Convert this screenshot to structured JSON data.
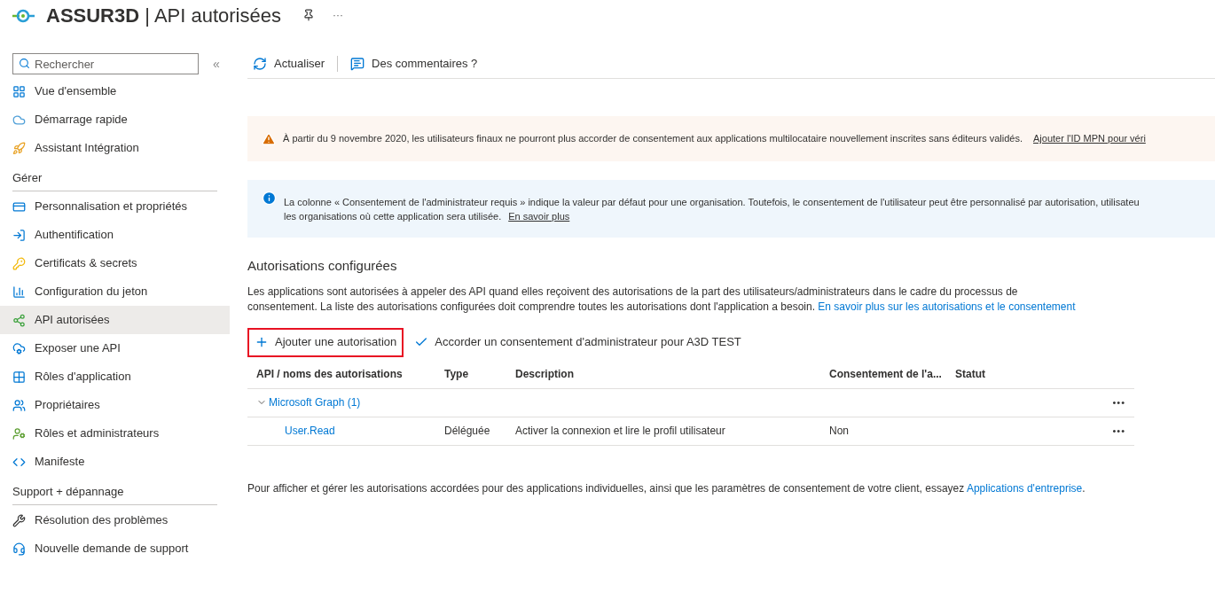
{
  "header": {
    "app_name": "ASSUR3D",
    "separator": "|",
    "page_title": "API autorisées",
    "more": "···"
  },
  "sidebar": {
    "search": {
      "placeholder": "Rechercher"
    },
    "collapse": "«",
    "groups": [
      {
        "items": [
          {
            "label": "Vue d'ensemble",
            "selected": false
          },
          {
            "label": "Démarrage rapide",
            "selected": false
          },
          {
            "label": "Assistant Intégration",
            "selected": false
          }
        ]
      },
      {
        "heading": "Gérer",
        "items": [
          {
            "label": "Personnalisation et propriétés",
            "selected": false
          },
          {
            "label": "Authentification",
            "selected": false
          },
          {
            "label": "Certificats & secrets",
            "selected": false
          },
          {
            "label": "Configuration du jeton",
            "selected": false
          },
          {
            "label": "API autorisées",
            "selected": true
          },
          {
            "label": "Exposer une API",
            "selected": false
          },
          {
            "label": "Rôles d'application",
            "selected": false
          },
          {
            "label": "Propriétaires",
            "selected": false
          },
          {
            "label": "Rôles et administrateurs",
            "selected": false
          },
          {
            "label": "Manifeste",
            "selected": false
          }
        ]
      },
      {
        "heading": "Support + dépannage",
        "items": [
          {
            "label": "Résolution des problèmes",
            "selected": false
          },
          {
            "label": "Nouvelle demande de support",
            "selected": false
          }
        ]
      }
    ]
  },
  "toolbar": [
    {
      "label": "Actualiser"
    },
    {
      "label": "Des commentaires ?"
    }
  ],
  "warning_banner": {
    "text": "À partir du 9 novembre 2020, les utilisateurs finaux ne pourront plus accorder de consentement aux applications multilocataire nouvellement inscrites sans éditeurs validés.",
    "link": "Ajouter l'ID MPN pour véri"
  },
  "info_banner": {
    "line_1": "La colonne « Consentement de l'administrateur requis » indique la valeur par défaut pour une organisation. Toutefois, le consentement de l'utilisateur peut être personnalisé par autorisation, utilisateu",
    "line_2": "les organisations où cette application sera utilisée.",
    "link": "En savoir plus"
  },
  "section": {
    "title": "Autorisations configurées",
    "description": "Les applications sont autorisées à appeler des API quand elles reçoivent des autorisations de la part des utilisateurs/administrateurs dans le cadre du processus de consentement. La liste des autorisations configurées doit comprendre toutes les autorisations dont l'application a besoin.",
    "link": "En savoir plus sur les autorisations et le consentement"
  },
  "actions": [
    {
      "kind": "add",
      "label": "Ajouter une autorisation",
      "highlighted": true
    },
    {
      "kind": "grant",
      "label": "Accorder un consentement d'administrateur pour A3D TEST",
      "highlighted": false
    }
  ],
  "table": {
    "columns": [
      "API / noms des autorisations",
      "Type",
      "Description",
      "Consentement de l'a...",
      "Statut"
    ],
    "groups": [
      {
        "name": "Microsoft Graph (1)",
        "expanded": true,
        "more": "•••",
        "rows": [
          {
            "cells": [
              "User.Read",
              "Déléguée",
              "Activer la connexion et lire le profil utilisateur",
              "Non"
            ],
            "more": "•••"
          }
        ]
      }
    ]
  },
  "footer": {
    "text": "Pour afficher et gérer les autorisations accordées pour des applications individuelles, ainsi que les paramètres de consentement de votre client, essayez",
    "link": "Applications d'entreprise",
    "end": "."
  }
}
